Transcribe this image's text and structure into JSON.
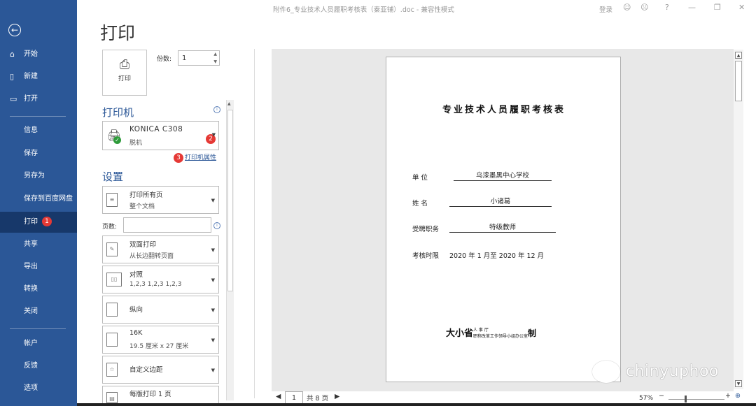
{
  "window": {
    "title": "附件6_专业技术人员履职考核表（秦亚铺）.doc - 兼容性模式",
    "login": "登录"
  },
  "sidebar": {
    "items": [
      {
        "label": "开始",
        "icon": "home-icon",
        "glyph": "⌂"
      },
      {
        "label": "新建",
        "icon": "new-doc-icon",
        "glyph": "▯"
      },
      {
        "label": "打开",
        "icon": "folder-icon",
        "glyph": "▭"
      },
      {
        "label": "信息"
      },
      {
        "label": "保存"
      },
      {
        "label": "另存为"
      },
      {
        "label": "保存到百度网盘"
      },
      {
        "label": "打印",
        "active": true,
        "badge": "1"
      },
      {
        "label": "共享"
      },
      {
        "label": "导出"
      },
      {
        "label": "转换"
      },
      {
        "label": "关闭"
      },
      {
        "label": "帐户"
      },
      {
        "label": "反馈"
      },
      {
        "label": "选项"
      }
    ]
  },
  "print_panel": {
    "title": "打印",
    "print_button": "打印",
    "copies_label": "份数:",
    "copies_value": "1",
    "printer_section": "打印机",
    "printer_name": "KONICA C308",
    "printer_status": "脱机",
    "printer_badge": "2",
    "printer_props_badge": "3",
    "printer_props_link": "打印机属性",
    "settings_section": "设置",
    "pages_label": "页数:",
    "pages_value": "",
    "settings": [
      {
        "line1": "打印所有页",
        "line2": "整个文档",
        "icon": "pages-icon"
      },
      {
        "line1": "双面打印",
        "line2": "从长边翻转页面",
        "icon": "duplex-icon"
      },
      {
        "line1": "对照",
        "line2": "1,2,3    1,2,3    1,2,3",
        "icon": "collate-icon"
      },
      {
        "line1": "纵向",
        "line2": "",
        "icon": "portrait-icon"
      },
      {
        "line1": "16K",
        "line2": "19.5 厘米 x 27 厘米",
        "icon": "paper-size-icon"
      },
      {
        "line1": "自定义边距",
        "line2": "",
        "icon": "margins-icon"
      },
      {
        "line1": "每版打印 1 页",
        "line2": "",
        "icon": "pages-per-sheet-icon"
      }
    ]
  },
  "document": {
    "heading": "专业技术人员履职考核表",
    "fields": [
      {
        "label": "单    位",
        "value": "乌漆墨黑中心学校"
      },
      {
        "label": "姓    名",
        "value": "小诸葛"
      },
      {
        "label": "受聘职务",
        "value": "特级教师"
      },
      {
        "label": "考核时限",
        "value": "2020 年 1 月至 2020 年 12 月"
      }
    ],
    "footer_org": "大小省",
    "footer_small_top": "人    事    厅",
    "footer_small_bottom": "职称改革工作领导小组办公室",
    "footer_suffix": "制"
  },
  "pager": {
    "current": "1",
    "total": "共 8 页"
  },
  "zoom": "57%",
  "watermark": "chinyuphoo",
  "colors": {
    "sidebar": "#2b5797",
    "sidebar_active": "#17386a",
    "badge": "#e53935",
    "accent": "#2b5797"
  }
}
